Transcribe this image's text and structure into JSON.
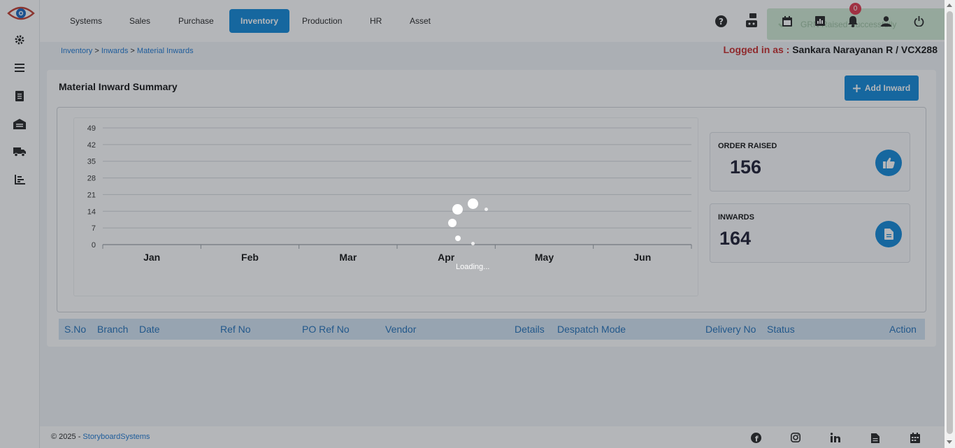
{
  "nav": {
    "tabs": [
      {
        "label": "Systems"
      },
      {
        "label": "Sales"
      },
      {
        "label": "Purchase"
      },
      {
        "label": "Inventory",
        "active": true
      },
      {
        "label": "Production"
      },
      {
        "label": "HR"
      },
      {
        "label": "Asset"
      }
    ]
  },
  "sidebar": {
    "icons": [
      "gear-icon",
      "menu-icon",
      "document-icon",
      "warehouse-icon",
      "truck-icon",
      "bar-chart-icon"
    ]
  },
  "header": {
    "notification_count": "0",
    "toast": "GRN Raised Successfully",
    "logged_in_label": "Logged in as :",
    "user": "Sankara Narayanan R / VCX288"
  },
  "breadcrumb": {
    "items": [
      "Inventory",
      "Inwards",
      "Material Inwards"
    ],
    "separator": ">"
  },
  "page": {
    "title": "Material Inward Summary",
    "add_button": "Add Inward"
  },
  "chart_data": {
    "type": "bar",
    "categories": [
      "Jan",
      "Feb",
      "Mar",
      "Apr",
      "May",
      "Jun"
    ],
    "series": [],
    "ylim": [
      0,
      49
    ],
    "yticks": [
      "0",
      "7",
      "14",
      "21",
      "28",
      "35",
      "42",
      "49"
    ],
    "grid": true
  },
  "stats": {
    "order_raised_label": "ORDER RAISED",
    "order_raised_value": "156",
    "inwards_label": "INWARDS",
    "inwards_value": "164"
  },
  "table": {
    "columns": [
      "S.No",
      "Branch",
      "Date",
      "Ref No",
      "PO Ref No",
      "Vendor",
      "Details",
      "Despatch Mode",
      "Delivery No",
      "Status",
      "Action"
    ]
  },
  "loader": {
    "text": "Loading..."
  },
  "footer": {
    "copyright": "© 2025 -",
    "company": "StoryboardSystems"
  },
  "colors": {
    "primary": "#0d86d8",
    "logged_label": "#c62828",
    "badge": "#e0334a",
    "table_header_bg": "#d3e3f3"
  }
}
